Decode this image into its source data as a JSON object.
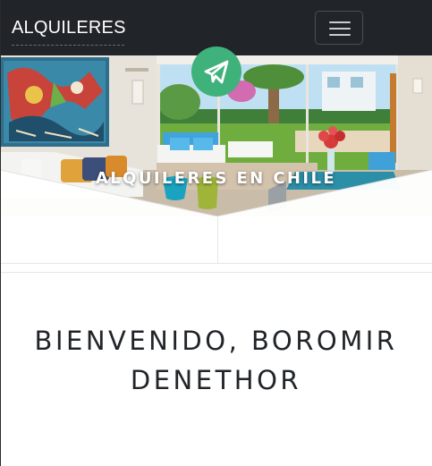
{
  "navbar": {
    "brand": "ALQUILERES",
    "toggle_icon": "hamburger-menu-icon"
  },
  "hero": {
    "title": "ALQUILERES EN CHILE",
    "action_icon": "paper-plane-icon",
    "accent_color": "#3fb17a"
  },
  "welcome": {
    "text": "BIENVENIDO, BOROMIR DENETHOR"
  }
}
